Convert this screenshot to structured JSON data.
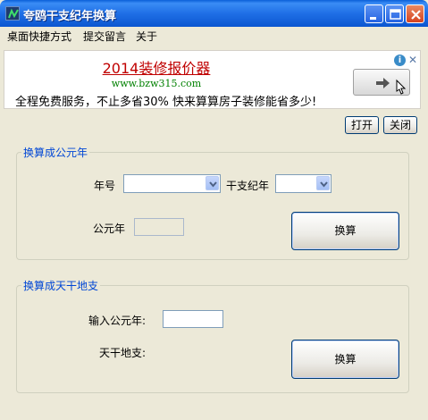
{
  "window": {
    "title": "夸鸥干支纪年换算"
  },
  "menu": [
    "桌面快捷方式",
    "提交留言",
    "关于"
  ],
  "ad": {
    "title": "2014装修报价器",
    "url": "www.bzw315.com",
    "description": "全程免费服务，不止多省30% 快来算算房子装修能省多少!",
    "info_glyph": "i",
    "close_glyph": "✕"
  },
  "toolbar": {
    "open_label": "打开",
    "close_label": "关闭"
  },
  "section_to_ad": {
    "legend": "换算成公元年",
    "year_label": "年号",
    "year_value": "",
    "ganzhi_label": "干支纪年",
    "ganzhi_value": "",
    "result_label": "公元年",
    "result_value": "",
    "convert_label": "换算"
  },
  "section_to_ganzhi": {
    "legend": "换算成天干地支",
    "input_label": "输入公元年:",
    "input_value": "",
    "result_label": "天干地支:",
    "result_value": "",
    "convert_label": "换算"
  }
}
